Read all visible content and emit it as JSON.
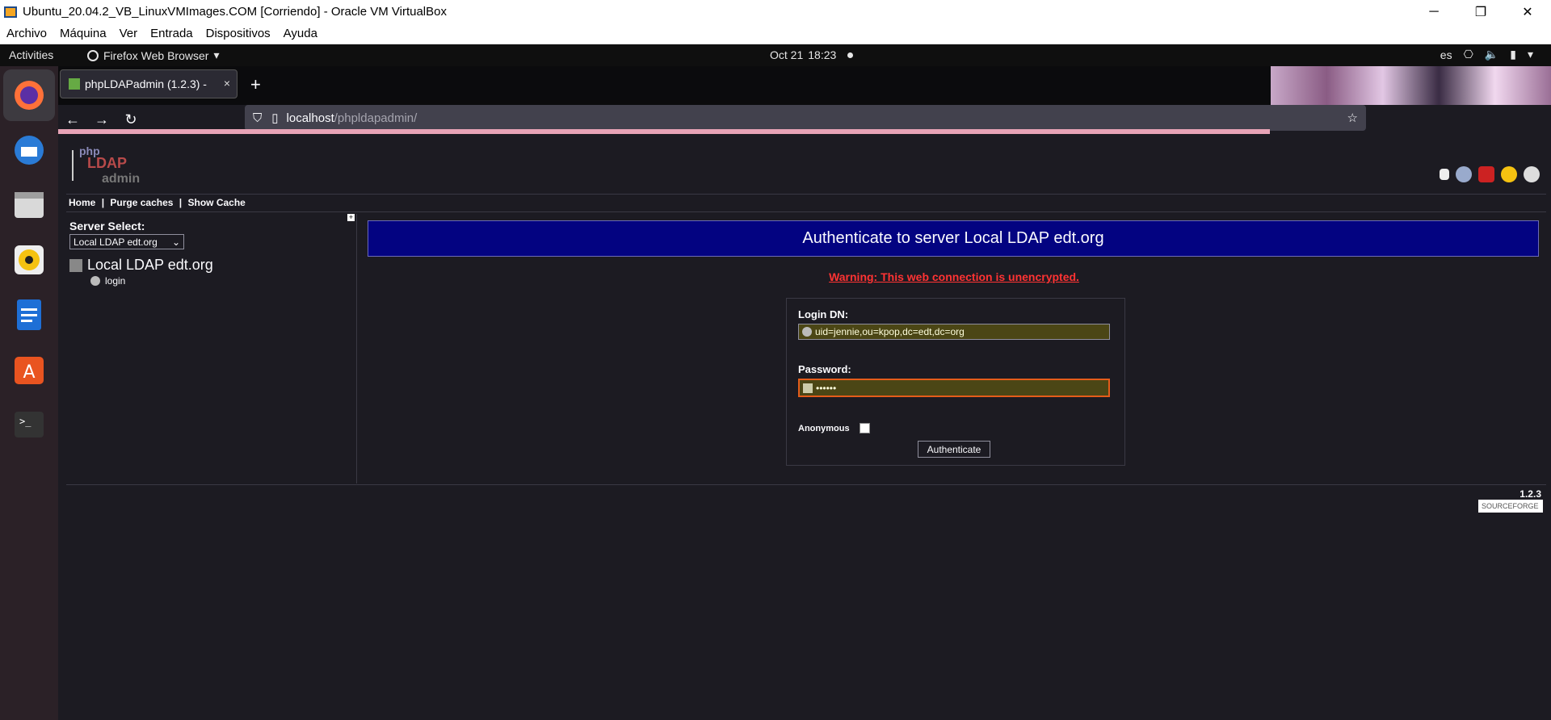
{
  "vbox": {
    "window_title": "Ubuntu_20.04.2_VB_LinuxVMImages.COM [Corriendo] - Oracle VM VirtualBox",
    "menu": [
      "Archivo",
      "Máquina",
      "Ver",
      "Entrada",
      "Dispositivos",
      "Ayuda"
    ],
    "controls": {
      "minimize": "─",
      "restore": "❐",
      "close": "✕"
    }
  },
  "gnome": {
    "activities": "Activities",
    "app_name": "Firefox Web Browser",
    "date": "Oct 21",
    "time": "18:23",
    "lang": "es"
  },
  "firefox": {
    "tab_title": "phpLDAPadmin (1.2.3) -",
    "tab_close": "×",
    "new_tab": "+",
    "url_host": "localhost",
    "url_path": "/phpldapadmin/",
    "nav": {
      "back": "←",
      "forward": "→",
      "reload": "↻"
    }
  },
  "page": {
    "menu": {
      "home": "Home",
      "purge": "Purge caches",
      "show_cache": "Show Cache",
      "sep": "|"
    },
    "server_select_label": "Server Select:",
    "server_select_value": "Local LDAP edt.org",
    "server_name": "Local LDAP edt.org",
    "login_link": "login",
    "auth_header": "Authenticate to server Local LDAP edt.org",
    "warning": "Warning: This web connection is unencrypted.",
    "login_dn_label": "Login DN:",
    "login_dn_value": "uid=jennie,ou=kpop,dc=edt,dc=org",
    "password_label": "Password:",
    "password_value": "••••••",
    "anonymous_label": "Anonymous",
    "authenticate_button": "Authenticate",
    "version": "1.2.3",
    "sourceforge": "SOURCEFORGE"
  }
}
